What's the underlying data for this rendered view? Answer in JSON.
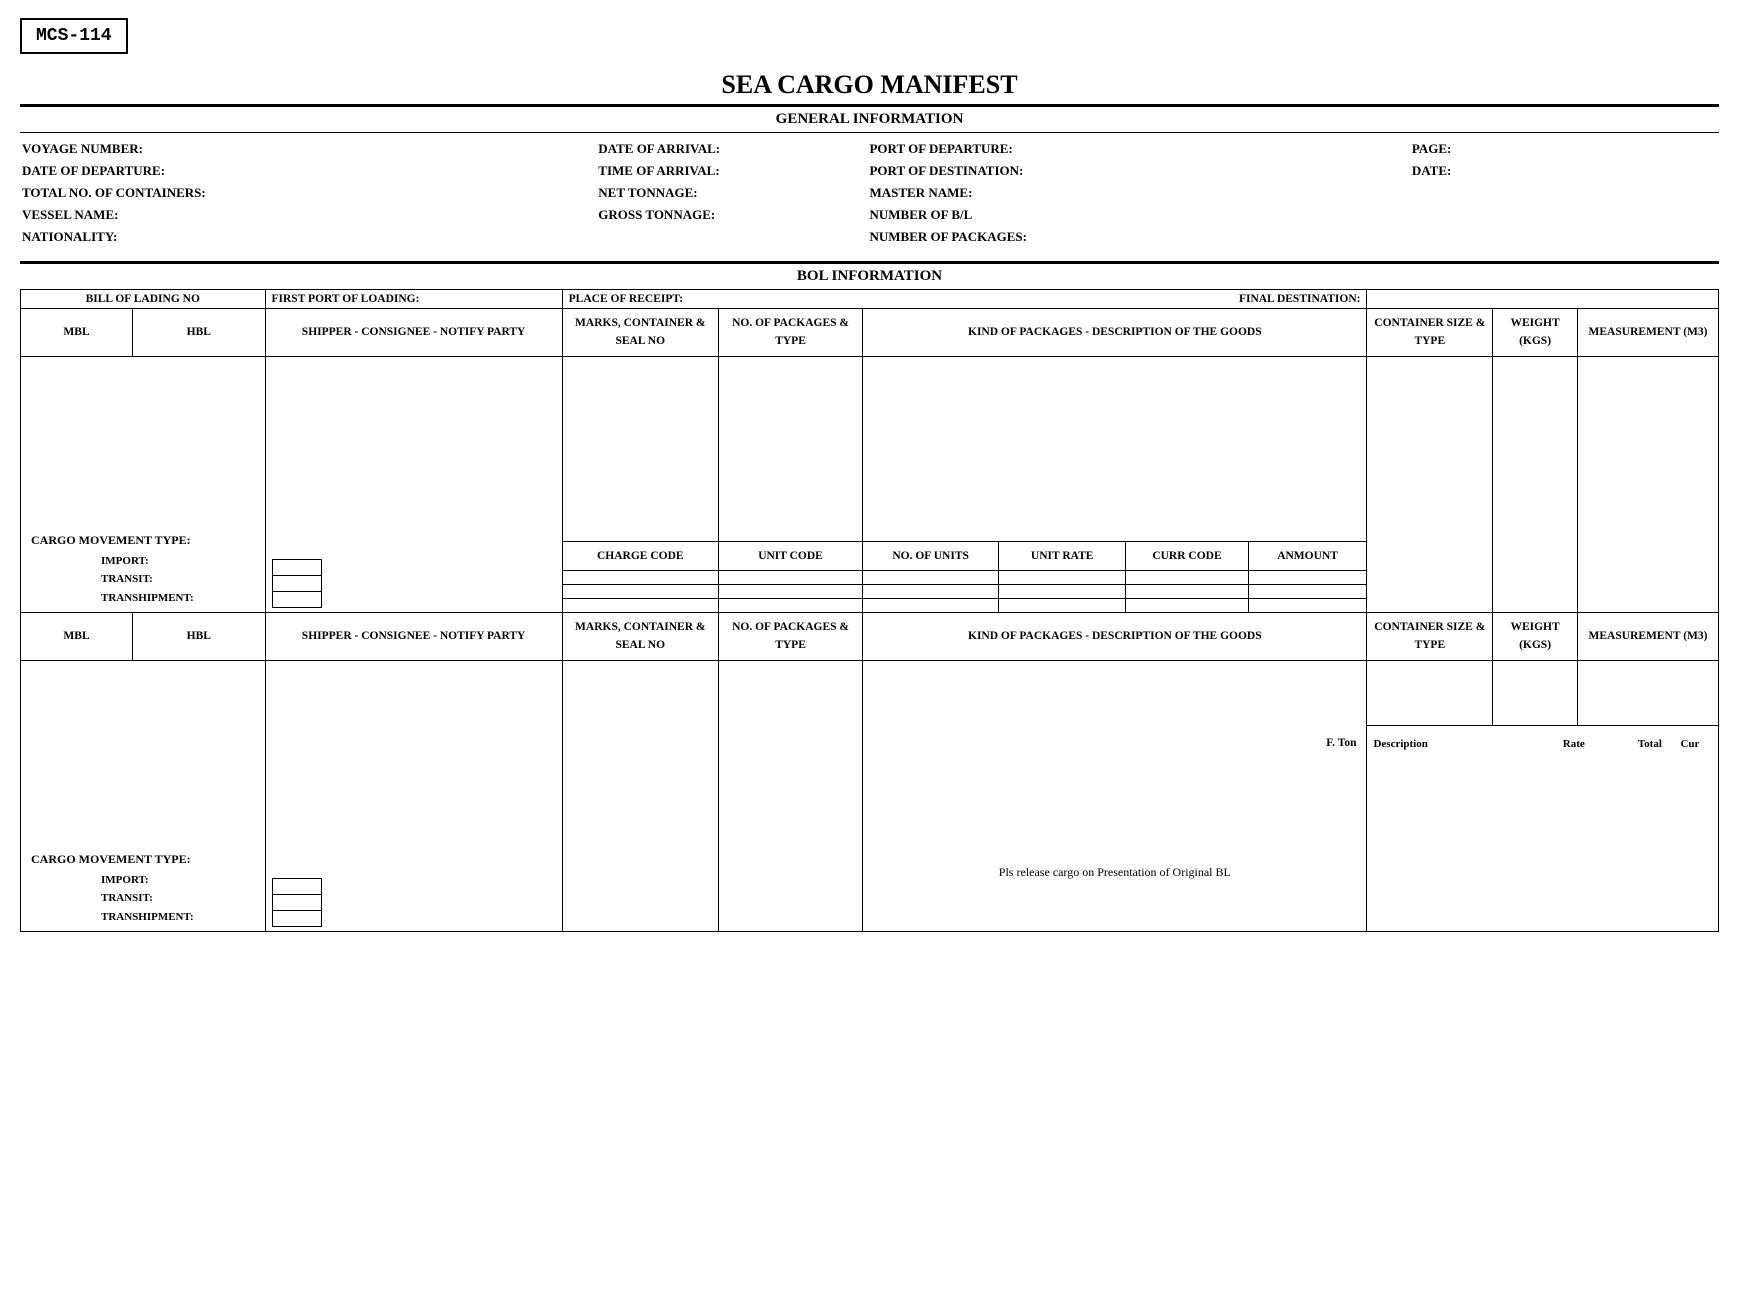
{
  "form_code": "MCS-114",
  "title": "SEA CARGO MANIFEST",
  "sections": {
    "general": "GENERAL INFORMATION",
    "bol": "BOL INFORMATION"
  },
  "general_info": {
    "voyage_number": "VOYAGE NUMBER:",
    "date_of_departure": "DATE OF DEPARTURE:",
    "total_containers": "TOTAL NO. OF CONTAINERS:",
    "vessel_name": "VESSEL NAME:",
    "nationality": "NATIONALITY:",
    "date_of_arrival": "DATE OF ARRIVAL:",
    "time_of_arrival": "TIME OF ARRIVAL:",
    "net_tonnage": "NET TONNAGE:",
    "gross_tonnage": "GROSS TONNAGE:",
    "port_of_departure": "PORT OF DEPARTURE:",
    "port_of_destination": "PORT OF DESTINATION:",
    "master_name": "MASTER NAME:",
    "number_of_bl": "NUMBER OF B/L",
    "number_of_packages": "NUMBER OF PACKAGES:",
    "page": "PAGE:",
    "date": "DATE:"
  },
  "bol_headers": {
    "bill_of_lading_no": "BILL OF LADING NO",
    "first_port_of_loading": "FIRST PORT OF LOADING:",
    "place_of_receipt": "PLACE OF RECEIPT:",
    "final_destination": "FINAL DESTINATION:",
    "mbl": "MBL",
    "hbl": "HBL",
    "shipper_consignee_notify": "SHIPPER - CONSIGNEE - NOTIFY PARTY",
    "marks_container_seal": "MARKS, CONTAINER & SEAL NO",
    "no_packages_type": "NO. OF PACKAGES & TYPE",
    "kind_description": "KIND OF PACKAGES - DESCRIPTION OF THE GOODS",
    "container_size_type": "CONTAINER SIZE & TYPE",
    "weight_kgs": "WEIGHT (KGS)",
    "measurement_m3": "MEASUREMENT (M3)"
  },
  "charge_headers": {
    "charge_code": "CHARGE CODE",
    "unit_code": "UNIT CODE",
    "no_of_units": "NO. OF UNITS",
    "unit_rate": "UNIT RATE",
    "curr_code": "CURR CODE",
    "anmount": "ANMOUNT"
  },
  "cargo_movement": {
    "title": "CARGO MOVEMENT TYPE:",
    "import": "IMPORT:",
    "transit": "TRANSIT:",
    "transhipment": "TRANSHIPMENT:"
  },
  "second_block": {
    "f_ton": "F. Ton",
    "description": "Description",
    "rate": "Rate",
    "total": "Total",
    "cur": "Cur",
    "release_note": "Pls release cargo on Presentation of Original BL"
  }
}
